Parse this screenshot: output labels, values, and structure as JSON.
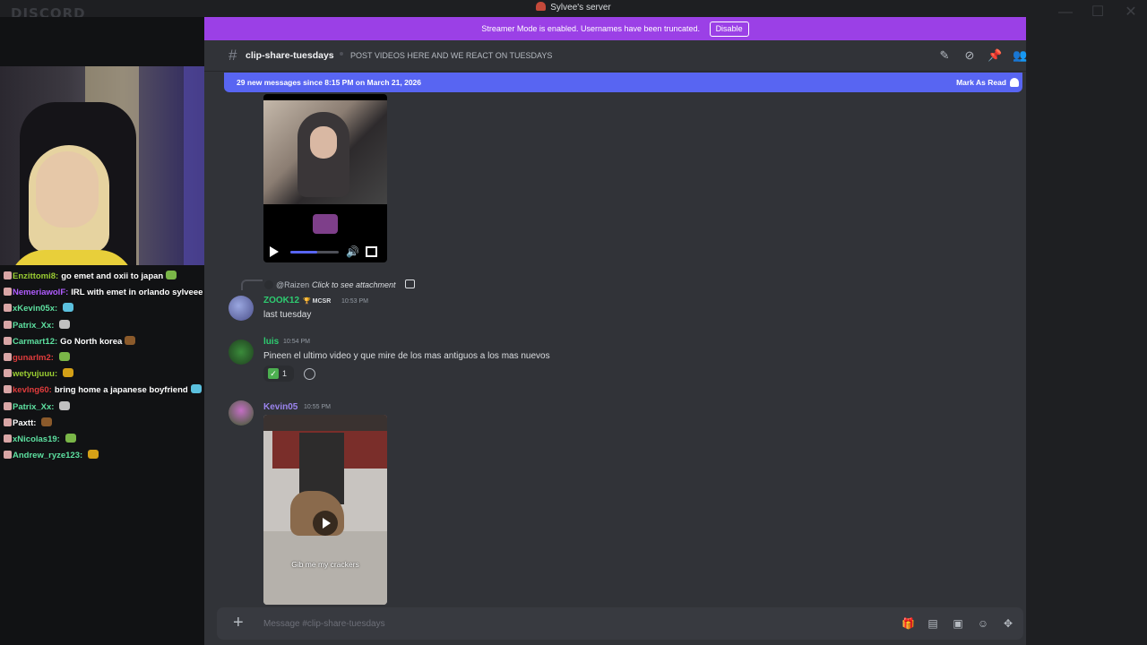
{
  "app": {
    "logo": "DISCORD",
    "server_name": "Sylvee's server"
  },
  "window_controls": {
    "minimize": "—",
    "maximize": "☐",
    "close": "✕"
  },
  "streamer_banner": {
    "text": "Streamer Mode is enabled. Usernames have been truncated.",
    "button": "Disable"
  },
  "channel": {
    "name": "clip-share-tuesdays",
    "topic": "POST VIDEOS HERE AND WE REACT ON TUESDAYS"
  },
  "new_messages": {
    "text": "29 new messages since 8:15 PM on March 21, 2026",
    "mark_read": "Mark As Read"
  },
  "messages": {
    "video1": {
      "progress": 0.55
    },
    "reply": {
      "user": "@Raizen",
      "text": "Click to see attachment"
    },
    "zook": {
      "user": "ZOOK12",
      "role": "MCSR",
      "time": "10:53 PM",
      "text": "last tuesday"
    },
    "luis": {
      "user": "luis",
      "time": "10:54 PM",
      "text": "Pineen el ultimo video y que mire de los mas antiguos a los mas nuevos",
      "reaction_count": "1"
    },
    "kevin": {
      "user": "Kevin05",
      "time": "10:55 PM",
      "caption": "Gib me my crackers"
    }
  },
  "composer": {
    "placeholder": "Message #clip-share-tuesdays"
  },
  "stream_chat": [
    {
      "user": "Enzittomi8:",
      "text": "go emet and oxii to japan",
      "color": "#9acd32"
    },
    {
      "user": "NemeriawolF:",
      "text": "IRL with emet in orlando sylveee",
      "color": "#b05cff"
    },
    {
      "user": "xKevin05x:",
      "text": "",
      "color": "#5de0a0"
    },
    {
      "user": "Patrix_Xx:",
      "text": "",
      "color": "#5de0a0"
    },
    {
      "user": "Carmart12:",
      "text": "Go North korea",
      "color": "#5de0a0"
    },
    {
      "user": "gunarlm2:",
      "text": "",
      "color": "#e03c3c"
    },
    {
      "user": "wetyujuuu:",
      "text": "",
      "color": "#9acd32"
    },
    {
      "user": "kevlng60:",
      "text": "bring home a japanese boyfriend",
      "color": "#e03c3c"
    },
    {
      "user": "Patrix_Xx:",
      "text": "",
      "color": "#5de0a0"
    },
    {
      "user": "Paxtt:",
      "text": "",
      "color": "#ffffff"
    },
    {
      "user": "xNicolas19:",
      "text": "",
      "color": "#5de0a0"
    },
    {
      "user": "Andrew_ryze123:",
      "text": "",
      "color": "#5de0a0"
    }
  ],
  "colors": {
    "accent": "#5865f2",
    "streamer": "#9b40e6",
    "zook": "#2ecc71",
    "luis": "#2ecc71",
    "kevin": "#9b84ee"
  }
}
